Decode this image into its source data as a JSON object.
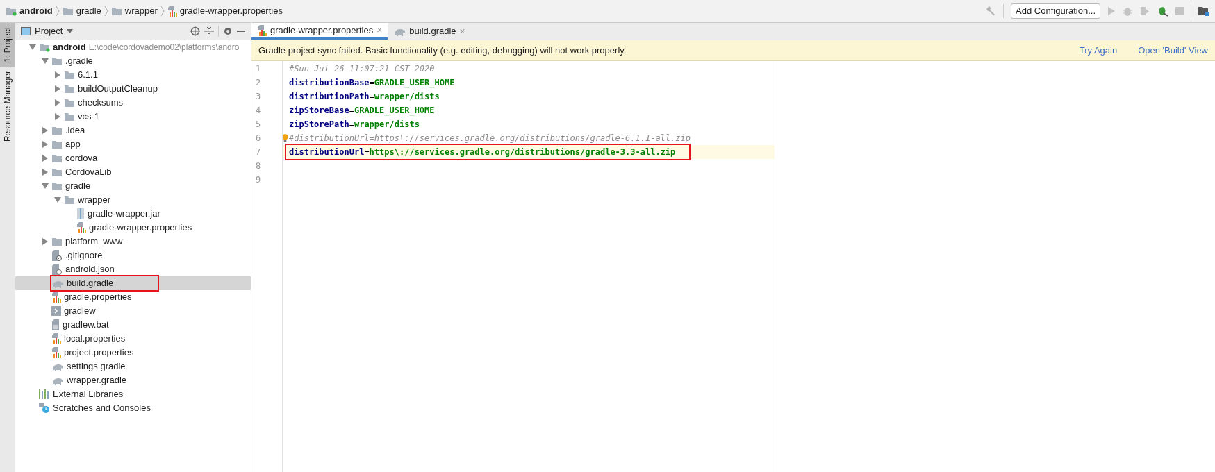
{
  "breadcrumbs": [
    {
      "label": "android",
      "kind": "module"
    },
    {
      "label": "gradle",
      "kind": "folder"
    },
    {
      "label": "wrapper",
      "kind": "folder"
    },
    {
      "label": "gradle-wrapper.properties",
      "kind": "properties"
    }
  ],
  "toolbar": {
    "config_button": "Add Configuration..."
  },
  "side_strip": [
    {
      "label": "1: Project",
      "selected": true
    },
    {
      "label": "Resource Manager",
      "selected": false
    }
  ],
  "project_panel": {
    "title": "Project",
    "tree": [
      {
        "label": "android",
        "path": "E:\\code\\cordovademo02\\platforms\\andro",
        "kind": "module",
        "expanded": true,
        "selected": false,
        "annotated": false,
        "children": [
          {
            "label": ".gradle",
            "kind": "folder",
            "expanded": true,
            "selected": false,
            "annotated": false,
            "children": [
              {
                "label": "6.1.1",
                "kind": "folder",
                "expanded": false,
                "selected": false,
                "annotated": false
              },
              {
                "label": "buildOutputCleanup",
                "kind": "folder",
                "expanded": false,
                "selected": false,
                "annotated": false
              },
              {
                "label": "checksums",
                "kind": "folder",
                "expanded": false,
                "selected": false,
                "annotated": false
              },
              {
                "label": "vcs-1",
                "kind": "folder",
                "expanded": false,
                "selected": false,
                "annotated": false
              }
            ]
          },
          {
            "label": ".idea",
            "kind": "folder",
            "expanded": false,
            "selected": false,
            "annotated": false
          },
          {
            "label": "app",
            "kind": "folder",
            "expanded": false,
            "selected": false,
            "annotated": false
          },
          {
            "label": "cordova",
            "kind": "folder",
            "expanded": false,
            "selected": false,
            "annotated": false
          },
          {
            "label": "CordovaLib",
            "kind": "folder",
            "expanded": false,
            "selected": false,
            "annotated": false
          },
          {
            "label": "gradle",
            "kind": "folder",
            "expanded": true,
            "selected": false,
            "annotated": false,
            "children": [
              {
                "label": "wrapper",
                "kind": "folder",
                "expanded": true,
                "selected": false,
                "annotated": false,
                "children": [
                  {
                    "label": "gradle-wrapper.jar",
                    "kind": "jar",
                    "selected": false,
                    "annotated": false
                  },
                  {
                    "label": "gradle-wrapper.properties",
                    "kind": "properties",
                    "selected": false,
                    "annotated": false
                  }
                ]
              }
            ]
          },
          {
            "label": "platform_www",
            "kind": "folder",
            "expanded": false,
            "selected": false,
            "annotated": false
          },
          {
            "label": ".gitignore",
            "kind": "gitignore",
            "selected": false,
            "annotated": false
          },
          {
            "label": "android.json",
            "kind": "json",
            "selected": false,
            "annotated": false
          },
          {
            "label": "build.gradle",
            "kind": "gradle",
            "selected": true,
            "annotated": true
          },
          {
            "label": "gradle.properties",
            "kind": "properties",
            "selected": false,
            "annotated": false
          },
          {
            "label": "gradlew",
            "kind": "shell",
            "selected": false,
            "annotated": false
          },
          {
            "label": "gradlew.bat",
            "kind": "bat",
            "selected": false,
            "annotated": false
          },
          {
            "label": "local.properties",
            "kind": "properties",
            "selected": false,
            "annotated": false
          },
          {
            "label": "project.properties",
            "kind": "properties",
            "selected": false,
            "annotated": false
          },
          {
            "label": "settings.gradle",
            "kind": "gradle",
            "selected": false,
            "annotated": false
          },
          {
            "label": "wrapper.gradle",
            "kind": "gradle",
            "selected": false,
            "annotated": false
          }
        ]
      },
      {
        "label": "External Libraries",
        "kind": "libraries",
        "selected": false,
        "annotated": false
      },
      {
        "label": "Scratches and Consoles",
        "kind": "scratches",
        "selected": false,
        "annotated": false
      }
    ]
  },
  "editor_tabs": [
    {
      "label": "gradle-wrapper.properties",
      "kind": "properties",
      "selected": true,
      "close": "×"
    },
    {
      "label": "build.gradle",
      "kind": "gradle",
      "selected": false,
      "close": "×"
    }
  ],
  "banner": {
    "message": "Gradle project sync failed. Basic functionality (e.g. editing, debugging) will not work properly.",
    "links": [
      "Try Again",
      "Open 'Build' View"
    ]
  },
  "code_lines": [
    {
      "number": "1",
      "kind": "comment",
      "text": "#Sun Jul 26 11:07:21 CST 2020",
      "current": false,
      "annotated": false
    },
    {
      "number": "2",
      "kind": "property",
      "key": "distributionBase",
      "sep": "=",
      "value": "GRADLE_USER_HOME",
      "current": false,
      "annotated": false
    },
    {
      "number": "3",
      "kind": "property",
      "key": "distributionPath",
      "sep": "=",
      "value": "wrapper/dists",
      "current": false,
      "annotated": false
    },
    {
      "number": "4",
      "kind": "property",
      "key": "zipStoreBase",
      "sep": "=",
      "value": "GRADLE_USER_HOME",
      "current": false,
      "annotated": false
    },
    {
      "number": "5",
      "kind": "property",
      "key": "zipStorePath",
      "sep": "=",
      "value": "wrapper/dists",
      "current": false,
      "annotated": false
    },
    {
      "number": "6",
      "kind": "comment",
      "text": "#distributionUrl=https\\://services.gradle.org/distributions/gradle-6.1.1-all.zip",
      "current": false,
      "annotated": false,
      "bulb": true
    },
    {
      "number": "7",
      "kind": "property",
      "key": "distributionUrl",
      "sep": "=",
      "value": "https\\://services.gradle.org/distributions/gradle-3.3-all.zip",
      "current": true,
      "annotated": true
    },
    {
      "number": "8",
      "kind": "blank",
      "current": false,
      "annotated": false
    },
    {
      "number": "9",
      "kind": "blank",
      "current": false,
      "annotated": false
    }
  ]
}
